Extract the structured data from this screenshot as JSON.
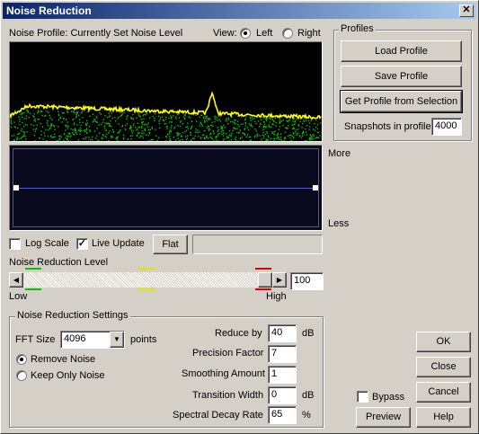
{
  "window": {
    "title": "Noise Reduction",
    "close_glyph": "✕"
  },
  "profile": {
    "label": "Noise Profile: Currently Set Noise Level",
    "view_label": "View:",
    "view_options": [
      "Left",
      "Right"
    ],
    "view_selected": "Left"
  },
  "display": {
    "more_label": "More",
    "less_label": "Less"
  },
  "options": {
    "log_scale_label": "Log Scale",
    "log_scale_checked": false,
    "live_update_label": "Live Update",
    "live_update_checked": true,
    "flat_label": "Flat"
  },
  "nr_level": {
    "label": "Noise Reduction Level",
    "low_label": "Low",
    "high_label": "High",
    "value": "100",
    "level_fraction": 1.0
  },
  "profiles": {
    "group_label": "Profiles",
    "load_label": "Load Profile",
    "save_label": "Save Profile",
    "get_label": "Get Profile from Selection",
    "snapshots_label": "Snapshots in profile",
    "snapshots_value": "4000"
  },
  "settings": {
    "group_label": "Noise Reduction Settings",
    "fft_label": "FFT Size",
    "fft_value": "4096",
    "fft_unit": "points",
    "remove_noise_label": "Remove Noise",
    "keep_noise_label": "Keep Only Noise",
    "mode_selected": "Remove Noise",
    "reduce_by_label": "Reduce by",
    "reduce_by_value": "40",
    "reduce_by_unit": "dB",
    "precision_label": "Precision Factor",
    "precision_value": "7",
    "smoothing_label": "Smoothing Amount",
    "smoothing_value": "1",
    "transition_label": "Transition Width",
    "transition_value": "0",
    "transition_unit": "dB",
    "decay_label": "Spectral Decay Rate",
    "decay_value": "65",
    "decay_unit": "%"
  },
  "actions": {
    "ok_label": "OK",
    "close_label": "Close",
    "cancel_label": "Cancel",
    "help_label": "Help",
    "preview_label": "Preview",
    "bypass_label": "Bypass",
    "bypass_checked": false
  },
  "colors": {
    "title_start": "#0a246a",
    "title_end": "#a6caf0",
    "spectrum_bg": "#000000",
    "noise_curve": "#ffff00",
    "noise_dots": "#00c800",
    "curve_line": "#3060ff",
    "editor_bg": "#0a0a1e",
    "mark_green": "#00c800",
    "mark_yellow": "#e6e600",
    "mark_red": "#e00000"
  }
}
